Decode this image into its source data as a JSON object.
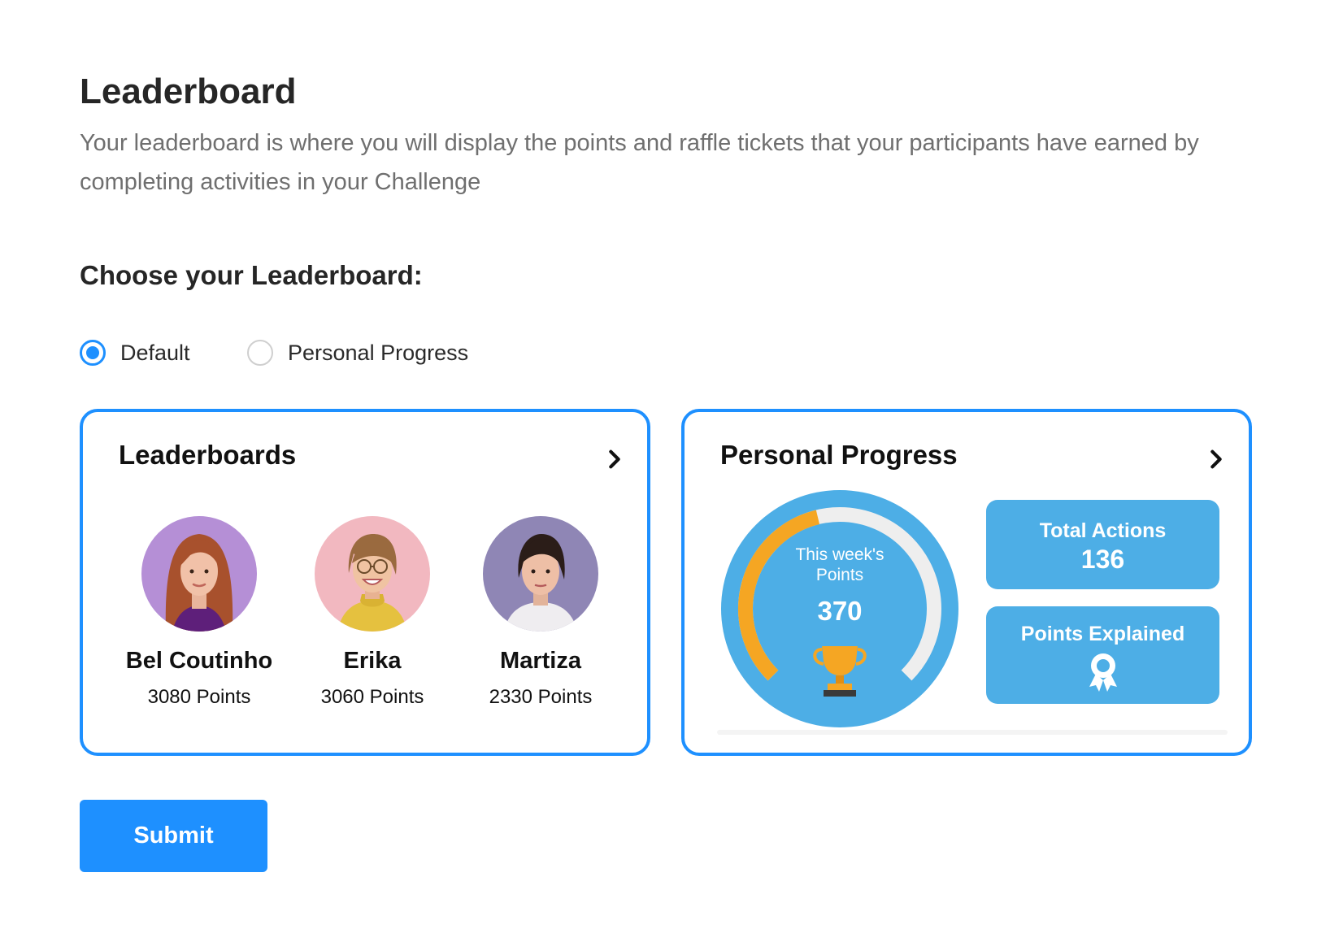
{
  "page": {
    "title": "Leaderboard",
    "description": "Your leaderboard is where you will display the points and raffle tickets that your participants have earned by completing activities in your Challenge"
  },
  "choose": {
    "title": "Choose your Leaderboard:",
    "options": [
      {
        "label": "Default",
        "selected": true
      },
      {
        "label": "Personal Progress",
        "selected": false
      }
    ]
  },
  "leaderboards_card": {
    "title": "Leaderboards",
    "icon": "chevron-right-icon",
    "people": [
      {
        "name": "Bel Coutinho",
        "points": "3080 Points",
        "avatar_bg": "#b58fd6"
      },
      {
        "name": "Erika",
        "points": "3060 Points",
        "avatar_bg": "#f2b8c0"
      },
      {
        "name": "Martiza",
        "points": "2330 Points",
        "avatar_bg": "#8f86b5"
      }
    ]
  },
  "progress_card": {
    "title": "Personal Progress",
    "icon": "chevron-right-icon",
    "gauge": {
      "label_line1": "This week's",
      "label_line2": "Points",
      "value": "370",
      "progress_fraction": 0.45,
      "icon": "trophy-icon"
    },
    "total_actions": {
      "label": "Total Actions",
      "value": "136"
    },
    "points_explained": {
      "label": "Points Explained",
      "icon": "award-ribbon-icon"
    }
  },
  "submit": {
    "label": "Submit"
  },
  "colors": {
    "accent": "#1e90ff",
    "card_blue": "#4daee6",
    "gauge_orange": "#f5a623",
    "gauge_track": "#eeeeee"
  }
}
